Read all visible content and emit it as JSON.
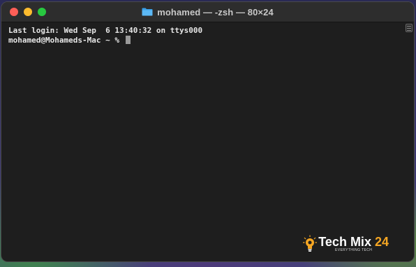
{
  "window": {
    "title": "mohamed — -zsh — 80×24",
    "title_icon": "folder-icon"
  },
  "terminal": {
    "lines": [
      "Last login: Wed Sep  6 13:40:32 on ttys000",
      "mohamed@Mohameds-Mac ~ % "
    ]
  },
  "watermark": {
    "brand_main": "Tech Mix",
    "brand_number": "24",
    "tagline": "EVERYTHING TECH"
  },
  "colors": {
    "close": "#ff5f57",
    "minimize": "#febc2e",
    "zoom": "#28c840",
    "terminal_bg": "#1e1e1e",
    "terminal_text": "#e6e6e6",
    "brand_accent": "#f5a623"
  }
}
